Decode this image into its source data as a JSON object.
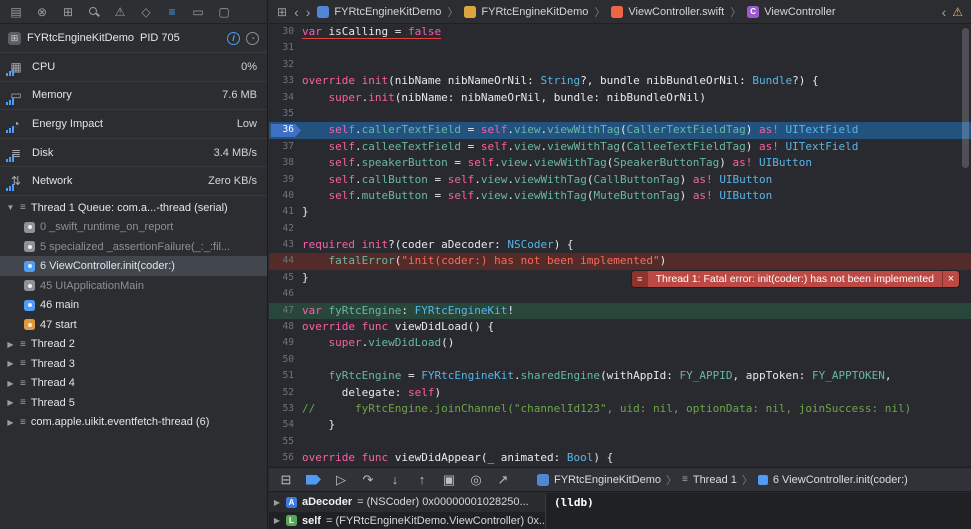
{
  "syntax_colors": {
    "keyword": "#fc5fa3",
    "type": "#56b6e8",
    "member": "#67b7a4",
    "string": "#fc6a5d",
    "comment": "#6da548",
    "plain": "#e9e9ea",
    "highlight_blue": "#24527f",
    "highlight_red": "#532b28",
    "highlight_green": "#28473a"
  },
  "navigator_bar": {
    "active_index": 6,
    "icons": [
      {
        "name": "project-navigator-icon",
        "glyph": "▤"
      },
      {
        "name": "source-control-icon",
        "glyph": "⊗"
      },
      {
        "name": "symbol-navigator-icon",
        "glyph": "⊞"
      },
      {
        "name": "search-icon",
        "css": "magnifier"
      },
      {
        "name": "issue-navigator-icon",
        "glyph": "⚠"
      },
      {
        "name": "test-navigator-icon",
        "glyph": "◇"
      },
      {
        "name": "debug-navigator-icon",
        "glyph": "≡"
      },
      {
        "name": "breakpoint-navigator-icon",
        "glyph": "▭"
      },
      {
        "name": "report-navigator-icon",
        "glyph": "▢"
      }
    ]
  },
  "jump_bar": {
    "related_items_glyph": "⊞",
    "back": "‹",
    "forward": "›",
    "crumbs": [
      {
        "type": "app",
        "label": "FYRtcEngineKitDemo"
      },
      {
        "type": "folder",
        "label": "FYRtcEngineKitDemo"
      },
      {
        "type": "swift-file",
        "label": "ViewController.swift"
      },
      {
        "type": "class-symbol",
        "label": "ViewController"
      }
    ],
    "issue_back_glyph": "‹",
    "warning_glyph": "⚠"
  },
  "sidebar": {
    "process": {
      "name": "FYRtcEngineKitDemo",
      "pid": "PID 705",
      "info_glyph": "i",
      "gauge_glyph": "◔"
    },
    "gauges": [
      {
        "label": "CPU",
        "value": "0%",
        "glyph": "▦"
      },
      {
        "label": "Memory",
        "value": "7.6 MB",
        "glyph": "▭"
      },
      {
        "label": "Energy Impact",
        "value": "Low",
        "glyph": "◔"
      },
      {
        "label": "Disk",
        "value": "3.4 MB/s",
        "glyph": "≣"
      },
      {
        "label": "Network",
        "value": "Zero KB/s",
        "glyph": "⇅"
      }
    ],
    "thread_group": {
      "disclosure": "▼",
      "label": "Thread 1 Queue: com.a...-thread (serial)",
      "frames": [
        {
          "num": "0",
          "label": "_swift_runtime_on_report",
          "icon": "gray",
          "dim": true
        },
        {
          "num": "5",
          "label": "specialized _assertionFailure(_:_:fil...",
          "icon": "gray",
          "dim": true
        },
        {
          "num": "6",
          "label": "ViewController.init(coder:)",
          "icon": "blue",
          "selected": true
        },
        {
          "num": "45",
          "label": "UIApplicationMain",
          "icon": "gray",
          "dim": true
        },
        {
          "num": "46",
          "label": "main",
          "icon": "blue"
        },
        {
          "num": "47",
          "label": "start",
          "icon": "orange"
        }
      ]
    },
    "other_threads": [
      {
        "disclosure": "▶",
        "label": "Thread 2"
      },
      {
        "disclosure": "▶",
        "label": "Thread 3"
      },
      {
        "disclosure": "▶",
        "label": "Thread 4"
      },
      {
        "disclosure": "▶",
        "label": "Thread 5"
      },
      {
        "disclosure": "▶",
        "label": "com.apple.uikit.eventfetch-thread (6)"
      }
    ]
  },
  "editor": {
    "first_line": 30,
    "line_height": 16.4,
    "breakpoint_line": 36,
    "lines": [
      {
        "n": 30,
        "u": true,
        "toks": [
          [
            "k",
            "var"
          ],
          [
            "p",
            " isCalling = "
          ],
          [
            "k",
            "false"
          ]
        ]
      },
      {
        "n": 31,
        "toks": []
      },
      {
        "n": 32,
        "toks": []
      },
      {
        "n": 33,
        "toks": [
          [
            "k",
            "override"
          ],
          [
            "p",
            " "
          ],
          [
            "k",
            "init"
          ],
          [
            "p",
            "(nibName nibNameOrNil: "
          ],
          [
            "t",
            "String"
          ],
          [
            "p",
            "?, bundle nibBundleOrNil: "
          ],
          [
            "t",
            "Bundle"
          ],
          [
            "p",
            "?) {"
          ]
        ]
      },
      {
        "n": 34,
        "toks": [
          [
            "p",
            "    "
          ],
          [
            "k",
            "super"
          ],
          [
            "p",
            "."
          ],
          [
            "k",
            "init"
          ],
          [
            "p",
            "(nibName: nibNameOrNil, bundle: nibBundleOrNil)"
          ]
        ]
      },
      {
        "n": 35,
        "toks": []
      },
      {
        "n": 36,
        "hl": "blue",
        "toks": [
          [
            "p",
            "    "
          ],
          [
            "k",
            "self"
          ],
          [
            "p",
            "."
          ],
          [
            "m",
            "callerTextField"
          ],
          [
            "p",
            " = "
          ],
          [
            "k",
            "self"
          ],
          [
            "p",
            "."
          ],
          [
            "m",
            "view"
          ],
          [
            "p",
            "."
          ],
          [
            "m",
            "viewWithTag"
          ],
          [
            "p",
            "("
          ],
          [
            "m",
            "CallerTextFieldTag"
          ],
          [
            "p",
            ") "
          ],
          [
            "k",
            "as!"
          ],
          [
            "p",
            " "
          ],
          [
            "t",
            "UITextField"
          ]
        ]
      },
      {
        "n": 37,
        "toks": [
          [
            "p",
            "    "
          ],
          [
            "k",
            "self"
          ],
          [
            "p",
            "."
          ],
          [
            "m",
            "calleeTextField"
          ],
          [
            "p",
            " = "
          ],
          [
            "k",
            "self"
          ],
          [
            "p",
            "."
          ],
          [
            "m",
            "view"
          ],
          [
            "p",
            "."
          ],
          [
            "m",
            "viewWithTag"
          ],
          [
            "p",
            "("
          ],
          [
            "m",
            "CalleeTextFieldTag"
          ],
          [
            "p",
            ") "
          ],
          [
            "k",
            "as!"
          ],
          [
            "p",
            " "
          ],
          [
            "t",
            "UITextField"
          ]
        ]
      },
      {
        "n": 38,
        "toks": [
          [
            "p",
            "    "
          ],
          [
            "k",
            "self"
          ],
          [
            "p",
            "."
          ],
          [
            "m",
            "speakerButton"
          ],
          [
            "p",
            " = "
          ],
          [
            "k",
            "self"
          ],
          [
            "p",
            "."
          ],
          [
            "m",
            "view"
          ],
          [
            "p",
            "."
          ],
          [
            "m",
            "viewWithTag"
          ],
          [
            "p",
            "("
          ],
          [
            "m",
            "SpeakerButtonTag"
          ],
          [
            "p",
            ") "
          ],
          [
            "k",
            "as!"
          ],
          [
            "p",
            " "
          ],
          [
            "t",
            "UIButton"
          ]
        ]
      },
      {
        "n": 39,
        "toks": [
          [
            "p",
            "    "
          ],
          [
            "k",
            "self"
          ],
          [
            "p",
            "."
          ],
          [
            "m",
            "callButton"
          ],
          [
            "p",
            " = "
          ],
          [
            "k",
            "self"
          ],
          [
            "p",
            "."
          ],
          [
            "m",
            "view"
          ],
          [
            "p",
            "."
          ],
          [
            "m",
            "viewWithTag"
          ],
          [
            "p",
            "("
          ],
          [
            "m",
            "CallButtonTag"
          ],
          [
            "p",
            ") "
          ],
          [
            "k",
            "as!"
          ],
          [
            "p",
            " "
          ],
          [
            "t",
            "UIButton"
          ]
        ]
      },
      {
        "n": 40,
        "toks": [
          [
            "p",
            "    "
          ],
          [
            "k",
            "self"
          ],
          [
            "p",
            "."
          ],
          [
            "m",
            "muteButton"
          ],
          [
            "p",
            " = "
          ],
          [
            "k",
            "self"
          ],
          [
            "p",
            "."
          ],
          [
            "m",
            "view"
          ],
          [
            "p",
            "."
          ],
          [
            "m",
            "viewWithTag"
          ],
          [
            "p",
            "("
          ],
          [
            "m",
            "MuteButtonTag"
          ],
          [
            "p",
            ") "
          ],
          [
            "k",
            "as!"
          ],
          [
            "p",
            " "
          ],
          [
            "t",
            "UIButton"
          ]
        ]
      },
      {
        "n": 41,
        "toks": [
          [
            "p",
            "}"
          ]
        ]
      },
      {
        "n": 42,
        "toks": []
      },
      {
        "n": 43,
        "toks": [
          [
            "k",
            "required"
          ],
          [
            "p",
            " "
          ],
          [
            "k",
            "init"
          ],
          [
            "p",
            "?(coder aDecoder: "
          ],
          [
            "t",
            "NSCoder"
          ],
          [
            "p",
            ") {"
          ]
        ]
      },
      {
        "n": 44,
        "hl": "red",
        "toks": [
          [
            "p",
            "    "
          ],
          [
            "m",
            "fatalError"
          ],
          [
            "p",
            "("
          ],
          [
            "s",
            "\"init(coder:) has not been implemented\""
          ],
          [
            "p",
            ")"
          ]
        ]
      },
      {
        "n": 45,
        "toks": [
          [
            "p",
            "}"
          ]
        ]
      },
      {
        "n": 46,
        "toks": []
      },
      {
        "n": 47,
        "hl": "green",
        "toks": [
          [
            "k",
            "var"
          ],
          [
            "p",
            " "
          ],
          [
            "m",
            "fyRtcEngine"
          ],
          [
            "p",
            ": "
          ],
          [
            "t",
            "FYRtcEngineKit"
          ],
          [
            "p",
            "!"
          ]
        ]
      },
      {
        "n": 48,
        "toks": [
          [
            "k",
            "override"
          ],
          [
            "p",
            " "
          ],
          [
            "k",
            "func"
          ],
          [
            "p",
            " viewDidLoad() {"
          ]
        ]
      },
      {
        "n": 49,
        "toks": [
          [
            "p",
            "    "
          ],
          [
            "k",
            "super"
          ],
          [
            "p",
            "."
          ],
          [
            "m",
            "viewDidLoad"
          ],
          [
            "p",
            "()"
          ]
        ]
      },
      {
        "n": 50,
        "toks": []
      },
      {
        "n": 51,
        "toks": [
          [
            "p",
            "    "
          ],
          [
            "m",
            "fyRtcEngine"
          ],
          [
            "p",
            " = "
          ],
          [
            "t",
            "FYRtcEngineKit"
          ],
          [
            "p",
            "."
          ],
          [
            "m",
            "sharedEngine"
          ],
          [
            "p",
            "(withAppId: "
          ],
          [
            "m",
            "FY_APPID"
          ],
          [
            "p",
            ", appToken: "
          ],
          [
            "m",
            "FY_APPTOKEN"
          ],
          [
            "p",
            ","
          ]
        ]
      },
      {
        "n": 52,
        "toks": [
          [
            "p",
            "      delegate: "
          ],
          [
            "k",
            "self"
          ],
          [
            "p",
            ")"
          ]
        ]
      },
      {
        "n": 53,
        "toks": [
          [
            "c",
            "//      fyRtcEngine.joinChannel(\"channelId123\", uid: nil, optionData: nil, joinSuccess: nil)"
          ]
        ]
      },
      {
        "n": 54,
        "toks": [
          [
            "p",
            "    }"
          ]
        ]
      },
      {
        "n": 55,
        "toks": []
      },
      {
        "n": 56,
        "toks": [
          [
            "k",
            "override"
          ],
          [
            "p",
            " "
          ],
          [
            "k",
            "func"
          ],
          [
            "p",
            " viewDidAppear(_ animated: "
          ],
          [
            "t",
            "Bool"
          ],
          [
            "p",
            ") {"
          ]
        ]
      }
    ],
    "annotation": {
      "line": 45,
      "icon_glyph": "≡",
      "text": "Thread 1: Fatal error: init(coder:) has not been implemented",
      "close_glyph": "×"
    }
  },
  "debug_bar": {
    "icons": [
      {
        "name": "hide-debug-area-icon",
        "glyph": "⊟"
      },
      {
        "name": "breakpoints-toggle-icon",
        "css": "bp-arrow"
      },
      {
        "name": "continue-icon",
        "glyph": "▷"
      },
      {
        "name": "step-over-icon",
        "glyph": "↷"
      },
      {
        "name": "step-into-icon",
        "glyph": "↓"
      },
      {
        "name": "step-out-icon",
        "glyph": "↑"
      },
      {
        "name": "view-debugger-icon",
        "glyph": "▣"
      },
      {
        "name": "memory-graph-icon",
        "glyph": "◎"
      },
      {
        "name": "simulate-location-icon",
        "glyph": "↗"
      }
    ],
    "crumbs": [
      {
        "type": "app",
        "label": "FYRtcEngineKitDemo"
      },
      {
        "type": "thread",
        "label": "Thread 1"
      },
      {
        "type": "frame",
        "label": "6 ViewController.init(coder:)"
      }
    ]
  },
  "console": {
    "variables": [
      {
        "badge": "A",
        "badge_color": "#3f7ae0",
        "name": "aDecoder",
        "value": "= (NSCoder) 0x00000001028250...",
        "disclosure": "▶"
      },
      {
        "badge": "L",
        "badge_color": "#55a85a",
        "name": "self",
        "value": "= (FYRtcEngineKitDemo.ViewController) 0x...",
        "disclosure": "▶"
      }
    ],
    "prompt": "(lldb)"
  }
}
